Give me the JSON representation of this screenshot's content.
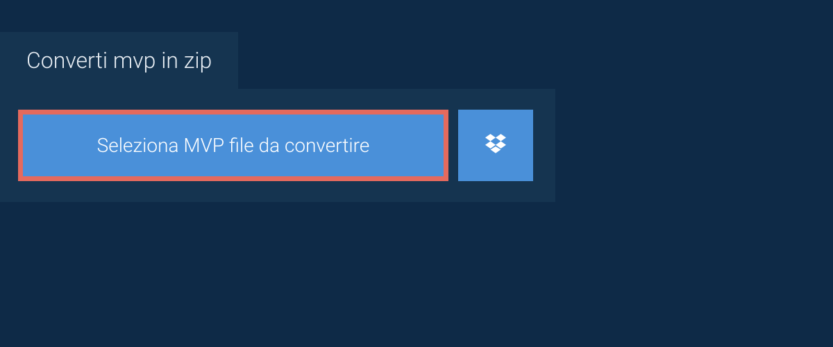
{
  "tab": {
    "title": "Converti mvp in zip"
  },
  "panel": {
    "select_button_label": "Seleziona MVP file da convertire"
  },
  "colors": {
    "background": "#0e2a47",
    "panel": "#153450",
    "button": "#4a90d9",
    "highlight_border": "#e46a5e",
    "text_light": "#ffffff"
  }
}
